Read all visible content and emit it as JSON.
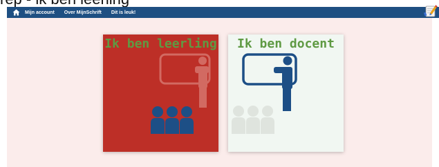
{
  "caption": "rep - ik ben leerling",
  "nav": {
    "home_icon": "home-icon",
    "items": [
      "Mijn account",
      "Over MijnSchrift",
      "Dit is leuk!"
    ],
    "right_icon": "pencil-tablet-icon"
  },
  "cards": [
    {
      "title": "Ik ben leerling",
      "background": "#bd2f27",
      "icon": "students-icon"
    },
    {
      "title": "Ik ben docent",
      "background": "#f1f7f2",
      "icon": "teacher-icon"
    }
  ],
  "colors": {
    "navbar": "#1e4f82",
    "page_background": "#fbeceb",
    "title_green": "#5f9a43",
    "figure_blue": "#1d4f86"
  }
}
